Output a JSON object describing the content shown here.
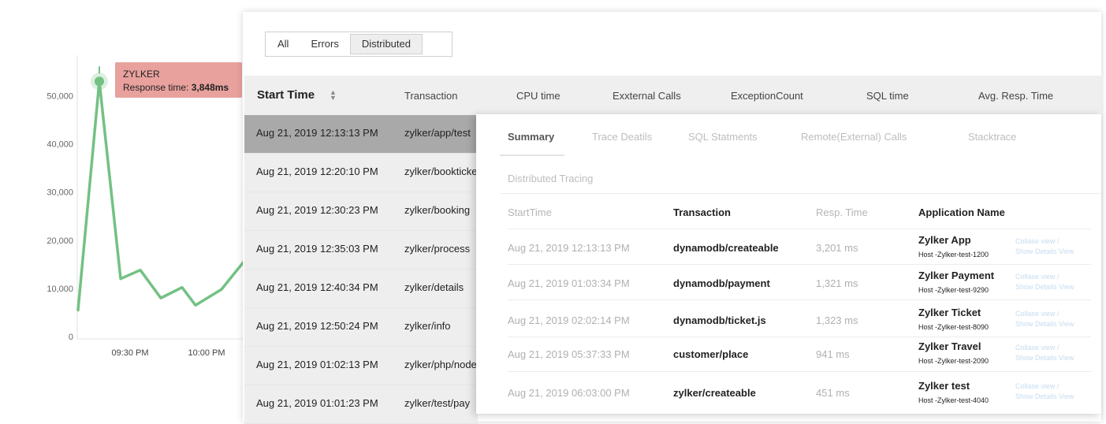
{
  "chart_data": {
    "type": "line",
    "tooltip": {
      "title": "ZYLKER",
      "label": "Response time:",
      "value": "3,848ms"
    },
    "y_ticks": [
      "50,000",
      "40,000",
      "30,000",
      "20,000",
      "10,000",
      "0"
    ],
    "x_ticks": [
      "09:30 PM",
      "10:00 PM"
    ],
    "color": "#73c183",
    "series": [
      {
        "values": [
          5500,
          53000,
          12000,
          13800,
          8000,
          10200,
          6500,
          9800,
          16500
        ]
      }
    ],
    "ylim": [
      0,
      55000
    ]
  },
  "filters": {
    "tabs": [
      "All",
      "Errors",
      "Distributed"
    ],
    "active": "Distributed"
  },
  "table": {
    "headers": {
      "start_time": "Start Time",
      "transaction": "Transaction",
      "cpu_time": "CPU time",
      "external_calls": "Exxternal Calls",
      "exception_count": "ExceptionCount",
      "sql_time": "SQL time",
      "avg_resp_time": "Avg. Resp. Time"
    },
    "rows": [
      {
        "time": "Aug 21, 2019 12:13:13 PM",
        "transaction": "zylker/app/test"
      },
      {
        "time": "Aug 21, 2019 12:20:10 PM",
        "transaction": "zylker/bookticket"
      },
      {
        "time": "Aug 21, 2019 12:30:23 PM",
        "transaction": "zylker/booking"
      },
      {
        "time": "Aug 21, 2019 12:35:03 PM",
        "transaction": "zylker/process"
      },
      {
        "time": "Aug 21, 2019 12:40:34 PM",
        "transaction": "zylker/details"
      },
      {
        "time": "Aug 21, 2019 12:50:24 PM",
        "transaction": "zylker/info"
      },
      {
        "time": "Aug 21, 2019 01:02:13 PM",
        "transaction": "zylker/php/node"
      },
      {
        "time": "Aug 21, 2019 01:01:23 PM",
        "transaction": "zylker/test/pay"
      }
    ]
  },
  "detail": {
    "tabs": [
      "Summary",
      "Trace Deatils",
      "SQL Statments",
      "Remote(External) Calls",
      "Stacktrace"
    ],
    "active_tab": "Summary",
    "section_title": "Distributed Tracing",
    "headers": {
      "start": "StartTime",
      "transaction": "Transaction",
      "resp": "Resp. Time",
      "app": "Application Name"
    },
    "rows": [
      {
        "start": "Aug 21, 2019 12:13:13 PM",
        "transaction": "dynamodb/createable",
        "resp": "3,201 ms",
        "app": "Zylker App",
        "host": "Host -Zylker-test-1200",
        "link1": "Collase view /",
        "link2": "Show Details View"
      },
      {
        "start": "Aug 21, 2019 01:03:34 PM",
        "transaction": "dynamodb/payment",
        "resp": "1,321 ms",
        "app": "Zylker Payment",
        "host": "Host -Zylker-test-9290",
        "link1": "Collase view /",
        "link2": "Show Details View"
      },
      {
        "start": "Aug 21, 2019 02:02:14 PM",
        "transaction": "dynamodb/ticket.js",
        "resp": "1,323 ms",
        "app": "Zylker Ticket",
        "host": "Host -Zylker-test-8090",
        "link1": "Collase view /",
        "link2": "Show Details View"
      },
      {
        "start": "Aug 21, 2019 05:37:33 PM",
        "transaction": "customer/place",
        "resp": "941 ms",
        "app": "Zylker Travel",
        "host": "Host -Zylker-test-2090",
        "link1": "Collase view /",
        "link2": "Show Details View"
      },
      {
        "start": "Aug 21, 2019 06:03:00 PM",
        "transaction": "zylker/createable",
        "resp": "451 ms",
        "app": "Zylker test",
        "host": "Host -Zylker-test-4040",
        "link1": "Collase view /",
        "link2": "Show Details View"
      }
    ]
  }
}
